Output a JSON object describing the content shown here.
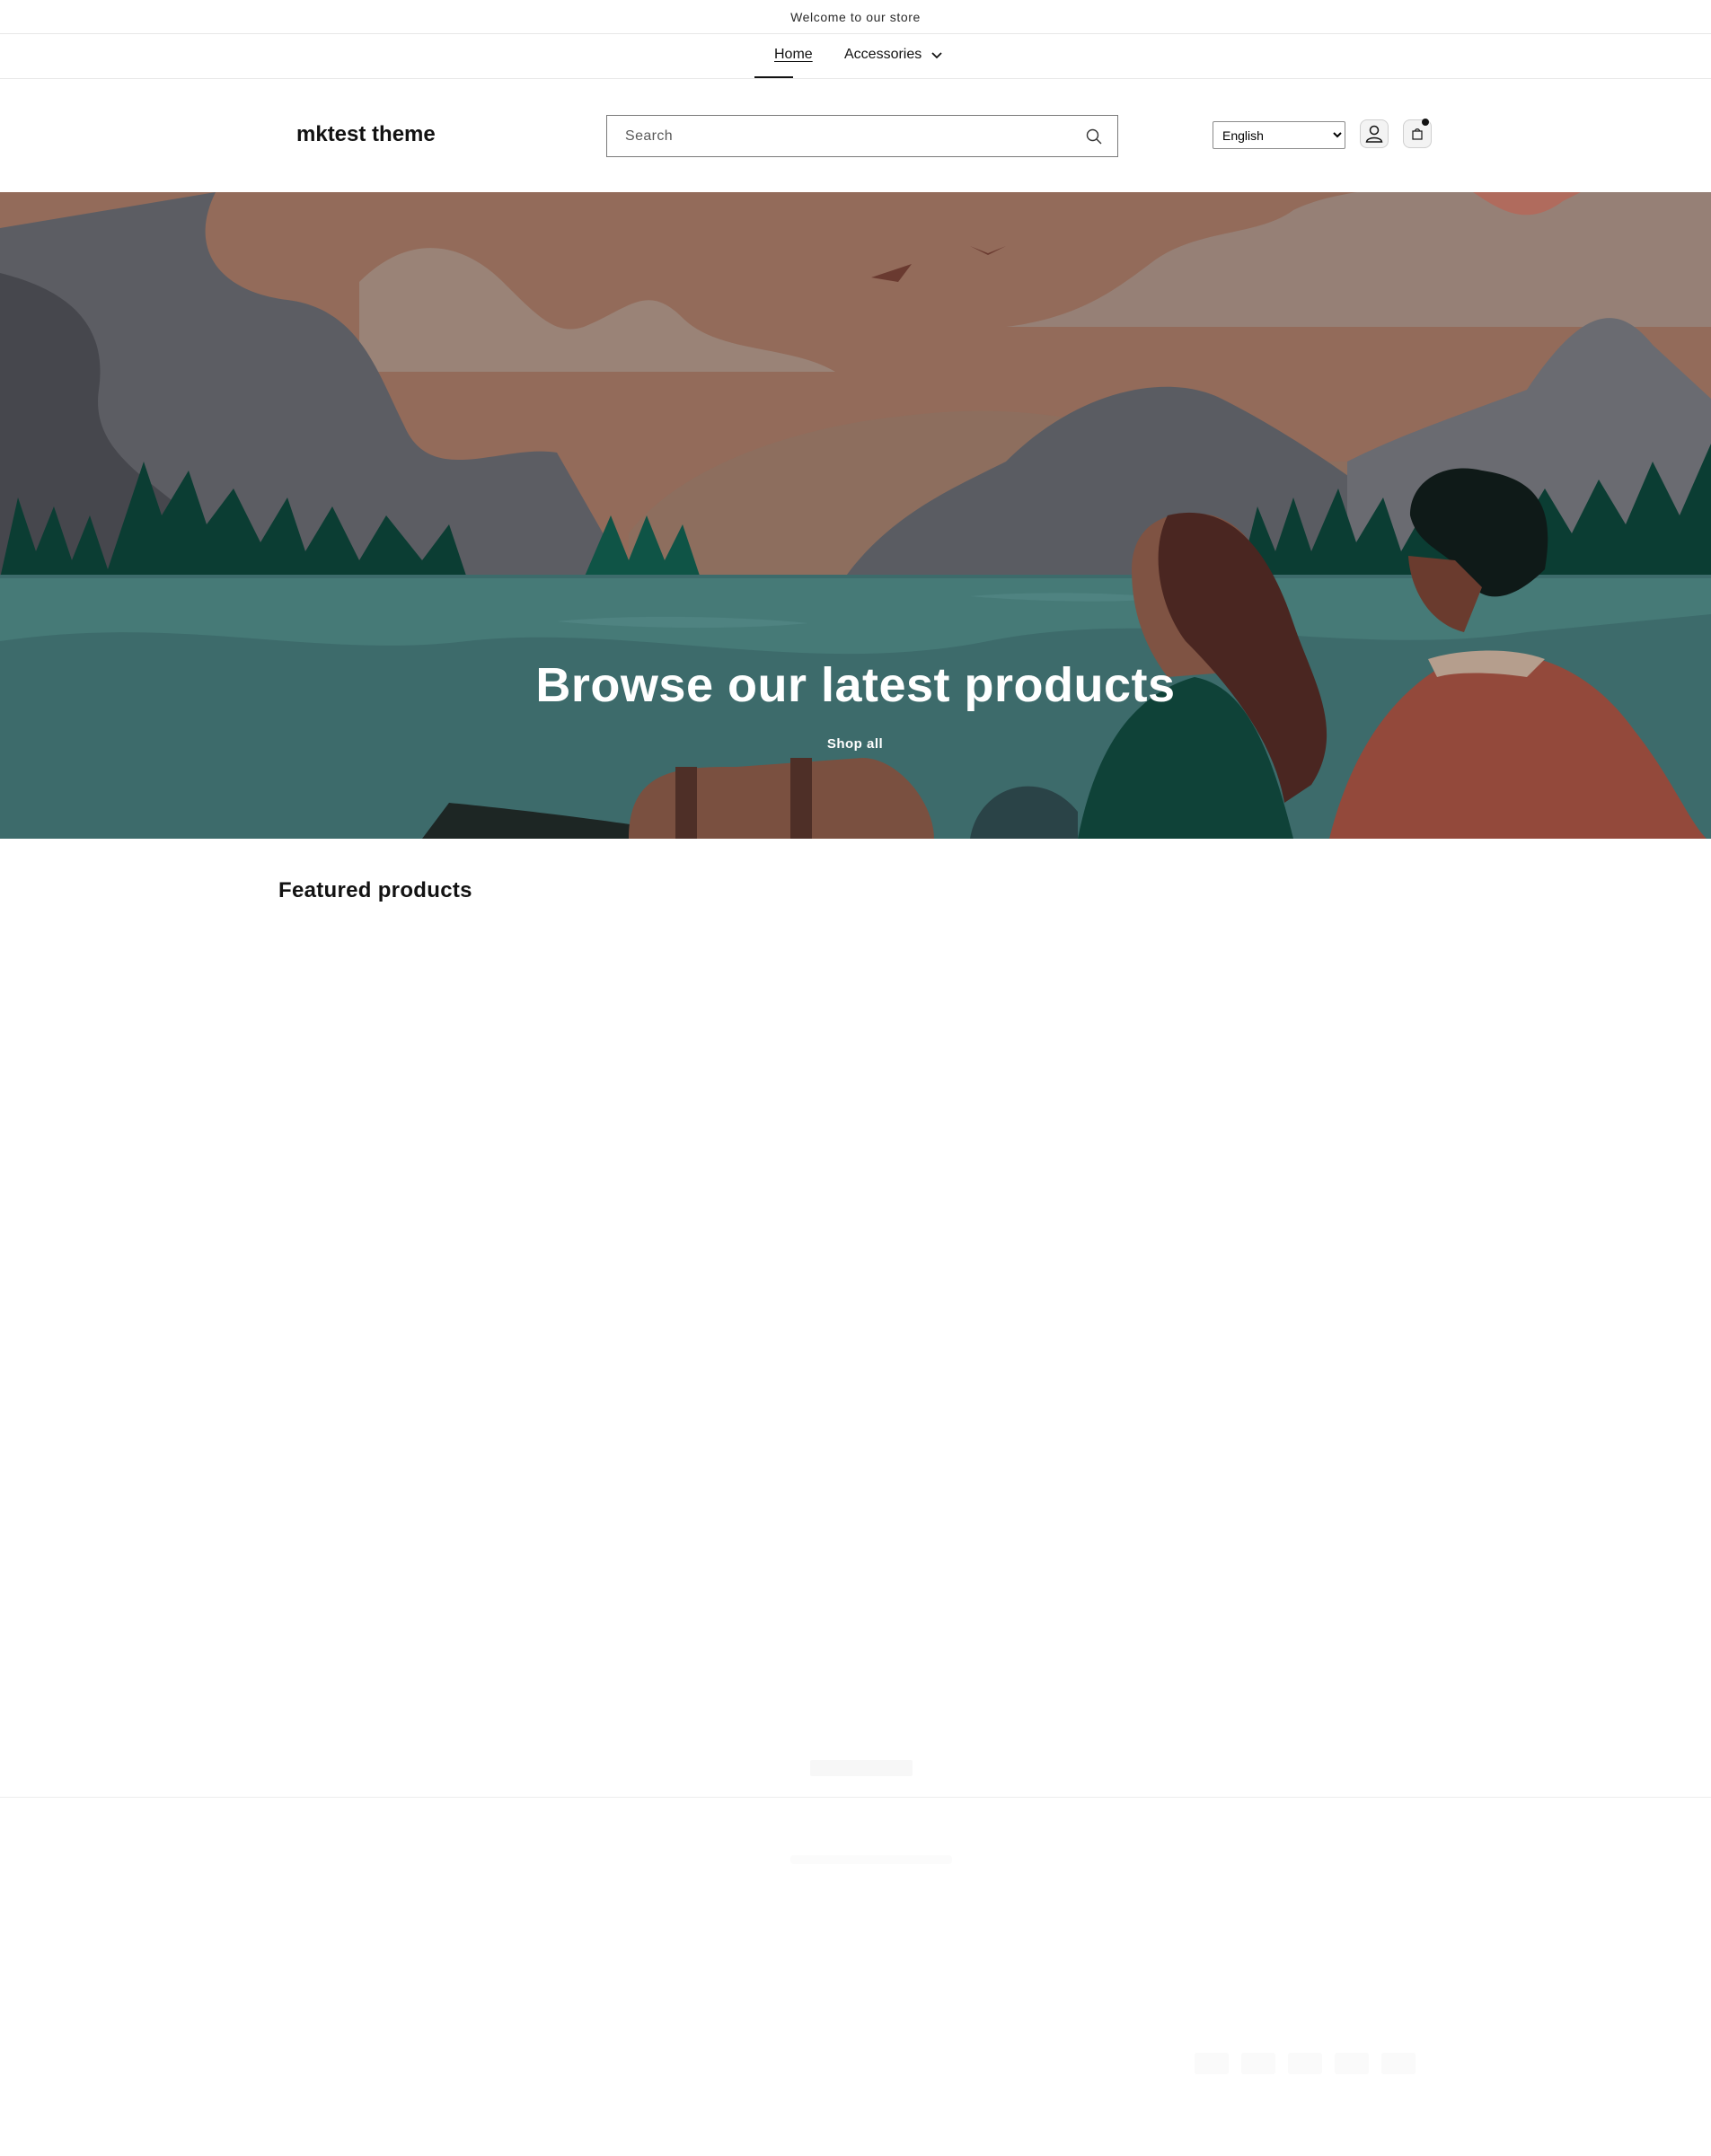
{
  "announcement": {
    "text": "Welcome to our store"
  },
  "nav": {
    "items": [
      {
        "label": "Home"
      },
      {
        "label": "Accessories"
      }
    ]
  },
  "header": {
    "logo": "mktest theme",
    "search": {
      "placeholder": "Search",
      "value": ""
    },
    "language": {
      "selected": "English"
    }
  },
  "hero": {
    "title": "Browse our latest products",
    "button": "Shop all"
  },
  "featured": {
    "heading": "Featured products"
  },
  "colors": {
    "sky": "#8d6e5e",
    "water": "#3d6b6b",
    "mountain": "#5a5c62",
    "forest": "#0b3d33",
    "text": "#121212"
  }
}
